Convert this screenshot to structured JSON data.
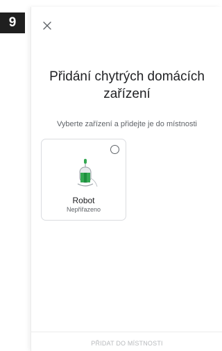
{
  "step_badge": "9",
  "header": {
    "close_icon": "close-icon"
  },
  "title": "Přidání chytrých domácích zařízení",
  "subtitle": "Vyberte zařízení a přidejte je do místnosti",
  "devices": [
    {
      "name": "Robot",
      "status": "Nepřiřazeno",
      "icon": "robot-vacuum-icon",
      "selected": false
    }
  ],
  "footer": {
    "add_button_label": "PŘIDAT DO MÍSTNOSTI",
    "add_button_enabled": false
  },
  "colors": {
    "accent_green": "#34a853",
    "disabled_text": "#b8babd"
  }
}
